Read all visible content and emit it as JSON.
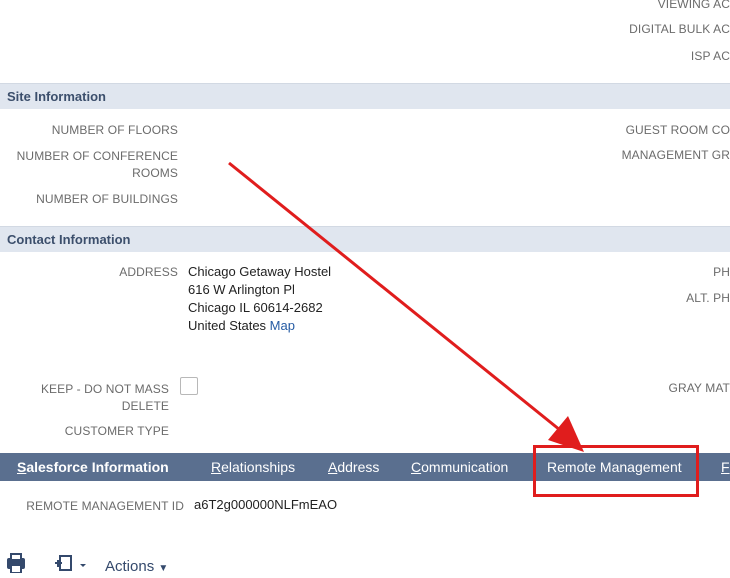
{
  "top_right_labels": [
    "VIEWING AC",
    "DIGITAL BULK AC",
    "ISP AC"
  ],
  "site_information": {
    "title": "Site Information",
    "fields": {
      "floors_label": "NUMBER OF FLOORS",
      "conference_label_line1": "NUMBER OF CONFERENCE",
      "conference_label_line2": "ROOMS",
      "buildings_label": "NUMBER OF BUILDINGS",
      "guest_room_label": "GUEST ROOM CO",
      "management_group_label": "MANAGEMENT GR"
    }
  },
  "contact_information": {
    "title": "Contact Information",
    "address_label": "ADDRESS",
    "address_lines": [
      "Chicago Getaway Hostel",
      "616 W Arlington Pl",
      "Chicago IL 60614-2682"
    ],
    "address_country": "United States",
    "map_link": "Map",
    "phone_label": "PH",
    "alt_phone_label": "ALT. PH",
    "keep_label_line1": "KEEP - DO NOT MASS",
    "keep_label_line2": "DELETE",
    "gray_label": "GRAY MAT",
    "customer_type_label": "CUSTOMER TYPE"
  },
  "tabs": [
    {
      "first": "S",
      "rest": "alesforce Information"
    },
    {
      "first": "R",
      "rest": "elationships"
    },
    {
      "first": "A",
      "rest": "ddress"
    },
    {
      "first": "C",
      "rest": "ommunication"
    },
    {
      "first": "R",
      "pre": "",
      "rest": "emote Management"
    },
    {
      "first": "F",
      "rest": ""
    }
  ],
  "remote": {
    "label": "REMOTE MANAGEMENT ID",
    "value": "a6T2g000000NLFmEAO"
  },
  "toolbar": {
    "actions_label": "Actions"
  },
  "colors": {
    "tab_bar": "#5a6f8f",
    "section_bar": "#e0e6ef",
    "annotation_red": "#e01d1d",
    "link": "#255ba3"
  }
}
